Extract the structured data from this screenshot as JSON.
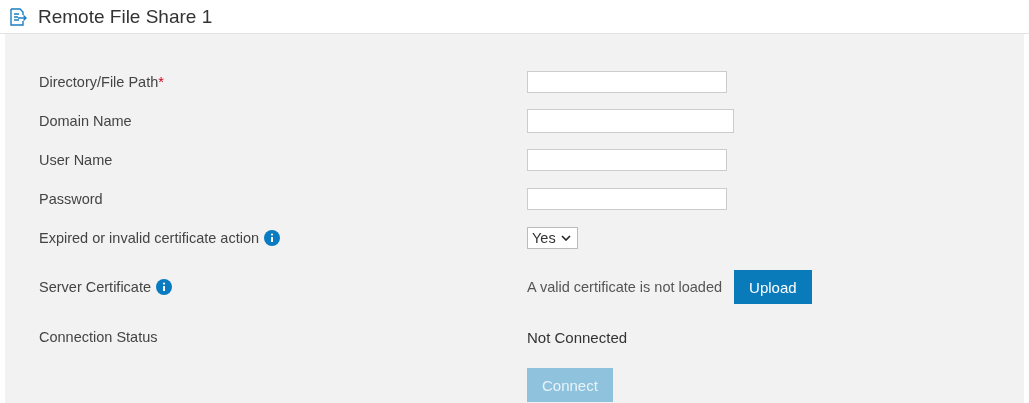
{
  "header": {
    "title": "Remote File Share 1"
  },
  "rows": [
    {
      "kind": "text",
      "label": "Directory/File Path",
      "required_mark": "*",
      "value": ""
    },
    {
      "kind": "text",
      "label": "Domain Name",
      "value": ""
    },
    {
      "kind": "text",
      "label": "User Name",
      "value": ""
    },
    {
      "kind": "password",
      "label": "Password",
      "value": ""
    },
    {
      "kind": "select",
      "label": "Expired or invalid certificate action",
      "info": true,
      "value": "Yes"
    },
    {
      "kind": "file",
      "label": "Server Certificate",
      "info": true,
      "status": "A valid certificate is not loaded",
      "button": "Upload"
    },
    {
      "kind": "status",
      "label": "Connection Status",
      "status": "Not Connected"
    },
    {
      "kind": "button",
      "button": "Connect",
      "disabled": true
    }
  ]
}
